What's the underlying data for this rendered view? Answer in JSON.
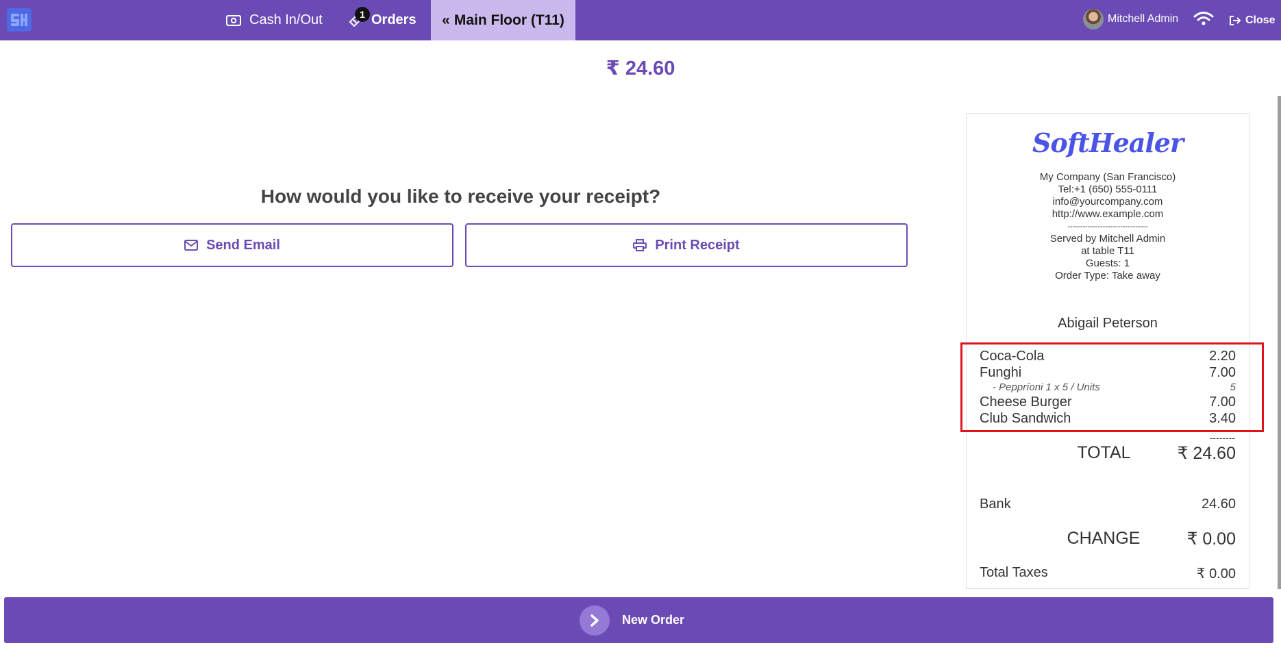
{
  "header": {
    "cash_label": "Cash In/Out",
    "orders_label": "Orders",
    "orders_badge": "1",
    "floor_label": "Main Floor (T11)",
    "user_name": "Mitchell Admin",
    "close_label": "Close"
  },
  "payment": {
    "amount": "₹ 24.60",
    "question": "How would you like to receive your receipt?",
    "send_email_label": "Send Email",
    "print_receipt_label": "Print Receipt"
  },
  "receipt": {
    "brand": "SoftHealer",
    "company_lines": [
      "My Company (San Francisco)",
      "Tel:+1 (650) 555-0111",
      "info@yourcompany.com",
      "http://www.example.com",
      "--------------------------------",
      "Served by Mitchell Admin",
      "at table T11",
      "Guests: 1",
      "Order Type: Take away"
    ],
    "customer": "Abigail Peterson",
    "lines": [
      {
        "name": "Coca-Cola",
        "amount": "2.20"
      },
      {
        "name": "Funghi",
        "amount": "7.00"
      },
      {
        "name": "- Peppríoni 1 x 5 / Units",
        "amount": "5"
      },
      {
        "name": "Cheese Burger",
        "amount": "7.00"
      },
      {
        "name": "Club Sandwich",
        "amount": "3.40"
      }
    ],
    "separator": "--------",
    "total_label": "TOTAL",
    "total_value": "₹ 24.60",
    "bank_label": "Bank",
    "bank_value": "24.60",
    "change_label": "CHANGE",
    "change_value": "₹ 0.00",
    "taxes_label": "Total Taxes",
    "taxes_value": "₹ 0.00"
  },
  "footer": {
    "new_order_label": "New Order"
  },
  "colors": {
    "primary": "#6a4bb5",
    "active_tab": "#c9b9ec",
    "brand_blue": "#4a55e6",
    "highlight": "#e0141a"
  }
}
